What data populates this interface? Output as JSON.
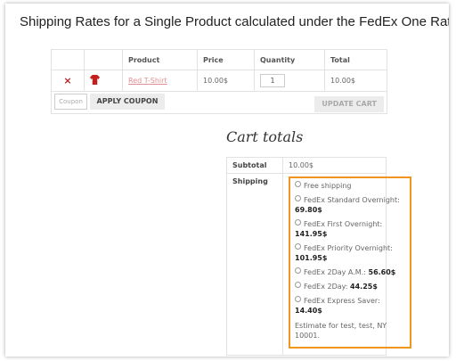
{
  "title": "Shipping Rates for a Single Product calculated under the FedEx One Rate",
  "cart": {
    "headers": {
      "product": "Product",
      "price": "Price",
      "quantity": "Quantity",
      "total": "Total"
    },
    "row": {
      "remove": "×",
      "product": "Red T-Shirt",
      "price": "10.00$",
      "quantity": "1",
      "total": "10.00$"
    },
    "coupon_placeholder": "Coupon",
    "apply_coupon": "APPLY COUPON",
    "update_cart": "UPDATE CART"
  },
  "totals": {
    "heading": "Cart totals",
    "subtotal_label": "Subtotal",
    "subtotal_value": "10.00$",
    "shipping_label": "Shipping",
    "options": [
      {
        "label": "Free shipping",
        "price": ""
      },
      {
        "label": "FedEx Standard Overnight:",
        "price": "69.80$"
      },
      {
        "label": "FedEx First Overnight:",
        "price": "141.95$"
      },
      {
        "label": "FedEx Priority Overnight:",
        "price": "101.95$"
      },
      {
        "label": "FedEx 2Day A.M.:",
        "price": "56.60$"
      },
      {
        "label": "FedEx 2Day:",
        "price": "44.25$"
      },
      {
        "label": "FedEx Express Saver:",
        "price": "14.40$"
      }
    ],
    "estimate": "Estimate for test, test, NY 10001."
  },
  "colors": {
    "highlight_border": "#f0961e",
    "remove": "#c21f1f"
  }
}
